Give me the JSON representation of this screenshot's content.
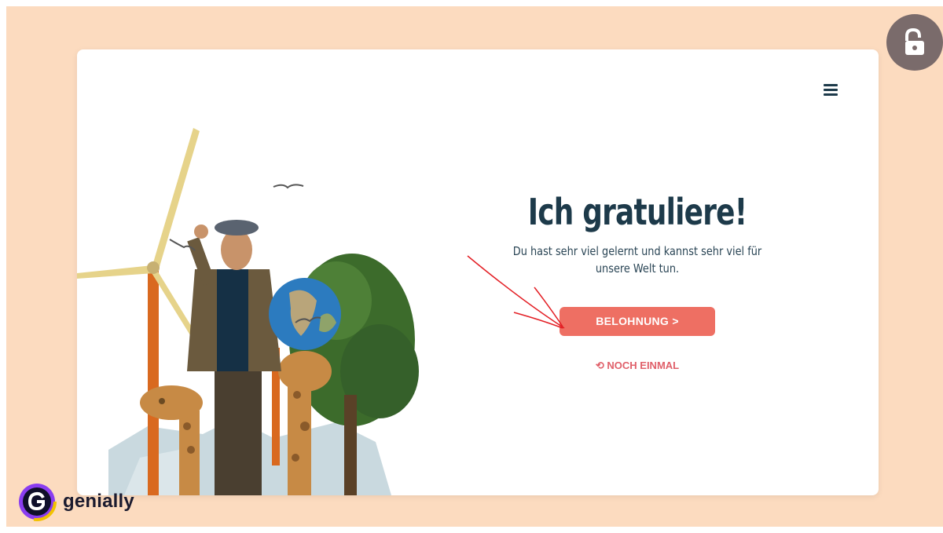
{
  "slide": {
    "title": "Ich gratuliere!",
    "subtitle": "Du hast sehr viel gelernt und kannst sehr viel für unsere Welt tun.",
    "reward_button": "BELOHNUNG >",
    "again_link": "⟲ NOCH EINMAL"
  },
  "brand": {
    "name": "genially"
  },
  "icons": {
    "menu": "hamburger-menu-icon",
    "lock": "unlock-hand-icon",
    "logo": "genially-logo-icon",
    "again": "undo-arrow-icon"
  },
  "colors": {
    "background": "#fcdbbf",
    "title": "#1d3a4a",
    "accent": "#ee6f63",
    "link": "#e0606a"
  }
}
